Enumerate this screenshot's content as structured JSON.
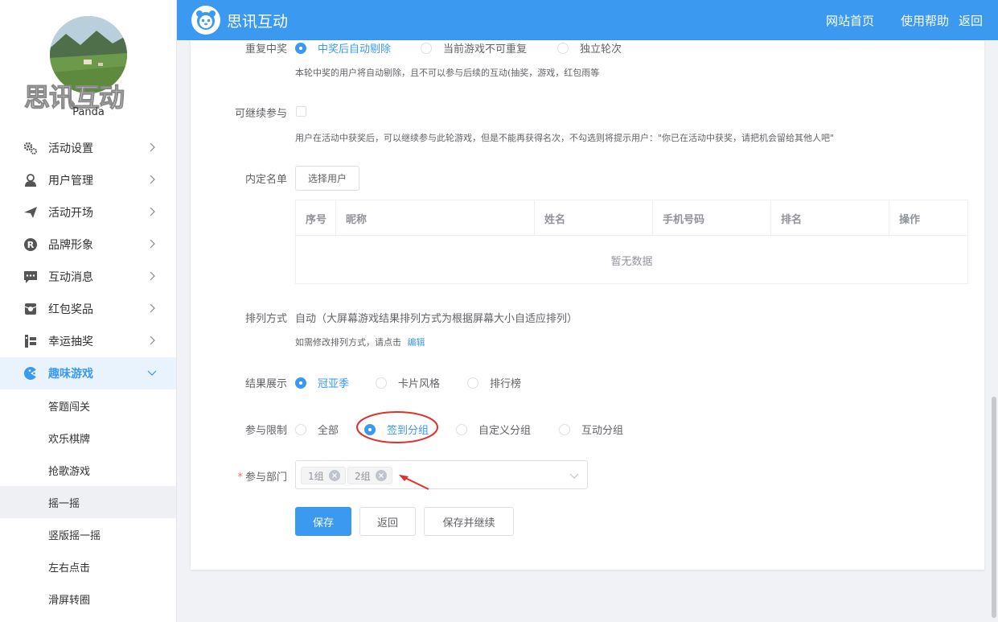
{
  "brand": {
    "name": "思讯互动"
  },
  "topnav": {
    "home": "网站首页",
    "help": "使用帮助",
    "back": "返回"
  },
  "user": {
    "watermark": "思讯互动",
    "name": "Panda"
  },
  "sidebar": {
    "items": [
      {
        "label": "活动设置",
        "icon": "gear-icon"
      },
      {
        "label": "用户管理",
        "icon": "user-icon"
      },
      {
        "label": "活动开场",
        "icon": "paper-plane-icon"
      },
      {
        "label": "品牌形象",
        "icon": "registered-icon"
      },
      {
        "label": "互动消息",
        "icon": "chat-icon"
      },
      {
        "label": "红包奖品",
        "icon": "gift-icon"
      },
      {
        "label": "幸运抽奖",
        "icon": "lottery-icon"
      },
      {
        "label": "趣味游戏",
        "icon": "game-icon"
      }
    ],
    "subitems": [
      "答题闯关",
      "欢乐棋牌",
      "抢歌游戏",
      "摇一摇",
      "竖版摇一摇",
      "左右点击",
      "滑屏转圈"
    ]
  },
  "form": {
    "repeat": {
      "label": "重复中奖",
      "options": [
        "中奖后自动剔除",
        "当前游戏不可重复",
        "独立轮次"
      ],
      "selected": "中奖后自动剔除",
      "hint": "本轮中奖的用户将自动剔除，且不可以参与后续的互动(抽奖，游戏，红包雨等"
    },
    "continue": {
      "label": "可继续参与",
      "hint": "用户在活动中获奖后，可以继续参与此轮游戏，但是不能再获得名次，不勾选则将提示用户：\"你已在活动中获奖，请把机会留给其他人吧\""
    },
    "preset": {
      "label": "内定名单",
      "button": "选择用户",
      "columns": [
        "序号",
        "昵称",
        "姓名",
        "手机号码",
        "排名",
        "操作"
      ],
      "empty": "暂无数据"
    },
    "arrange": {
      "label": "排列方式",
      "value": "自动（大屏幕游戏结果排列方式为根据屏幕大小自适应排列）",
      "hint": "如需修改排列方式，请点击",
      "link": "编辑"
    },
    "result": {
      "label": "结果展示",
      "options": [
        "冠亚季",
        "卡片风格",
        "排行榜"
      ],
      "selected": "冠亚季"
    },
    "limit": {
      "label": "参与限制",
      "options": [
        "全部",
        "签到分组",
        "自定义分组",
        "互动分组"
      ],
      "selected": "签到分组"
    },
    "dept": {
      "required": "*",
      "label": "参与部门",
      "tags": [
        "1组",
        "2组"
      ]
    },
    "buttons": {
      "save": "保存",
      "back": "返回",
      "save_continue": "保存并继续"
    }
  },
  "colors": {
    "primary": "#3b99f0",
    "annotation": "#e0312b"
  }
}
